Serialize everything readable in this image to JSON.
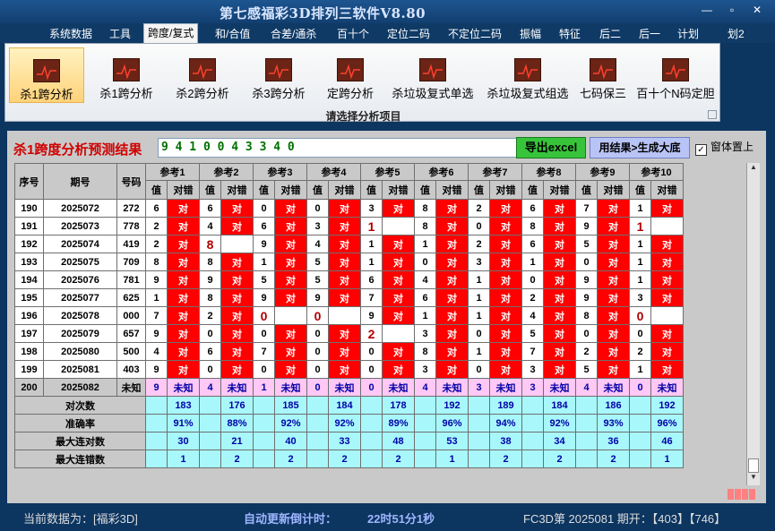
{
  "window": {
    "title": "第七感福彩3D排列三软件V8.80",
    "minimize": "—",
    "maximize": "▫",
    "close": "✕"
  },
  "menu": [
    "系统数据",
    "工具",
    "跨度/复式",
    "和/合值",
    "合差/通杀",
    "百十个",
    "定位二码",
    "不定位二码",
    "振幅",
    "特征",
    "后二",
    "后一",
    "计划",
    "划2"
  ],
  "ribbon": {
    "buttons": [
      "杀1跨分析",
      "杀1跨分析",
      "杀2跨分析",
      "杀3跨分析",
      "定跨分析",
      "杀垃圾复式单选",
      "杀垃圾复式组选",
      "七码保三",
      "百十个N码定胆"
    ],
    "caption": "请选择分析项目"
  },
  "result": {
    "label": "杀1跨度分析预测结果",
    "value": "9 4 1 0 0 4 3 3 4 0",
    "export_btn": "导出excel",
    "gen_btn": "用结果>生成大底",
    "topmost_label": "窗体置上",
    "topmost_checked": "✓"
  },
  "table": {
    "headers": [
      "序号",
      "期号",
      "号码"
    ],
    "refs": [
      "参考1",
      "参考2",
      "参考3",
      "参考4",
      "参考5",
      "参考6",
      "参考7",
      "参考8",
      "参考9",
      "参考10"
    ],
    "subheaders": [
      "值",
      "对错"
    ],
    "rows": [
      {
        "seq": "190",
        "period": "2025072",
        "num": "272",
        "cells": [
          [
            "6",
            "对"
          ],
          [
            "6",
            "对"
          ],
          [
            "0",
            "对"
          ],
          [
            "0",
            "对"
          ],
          [
            "3",
            "对"
          ],
          [
            "8",
            "对"
          ],
          [
            "2",
            "对"
          ],
          [
            "6",
            "对"
          ],
          [
            "7",
            "对"
          ],
          [
            "1",
            "对"
          ]
        ]
      },
      {
        "seq": "191",
        "period": "2025073",
        "num": "778",
        "cells": [
          [
            "2",
            "对"
          ],
          [
            "4",
            "对"
          ],
          [
            "6",
            "对"
          ],
          [
            "3",
            "对"
          ],
          [
            "1",
            ""
          ],
          [
            "8",
            "对"
          ],
          [
            "0",
            "对"
          ],
          [
            "8",
            "对"
          ],
          [
            "9",
            "对"
          ],
          [
            "1",
            ""
          ]
        ]
      },
      {
        "seq": "192",
        "period": "2025074",
        "num": "419",
        "cells": [
          [
            "2",
            "对"
          ],
          [
            "8",
            ""
          ],
          [
            "9",
            "对"
          ],
          [
            "4",
            "对"
          ],
          [
            "1",
            "对"
          ],
          [
            "1",
            "对"
          ],
          [
            "2",
            "对"
          ],
          [
            "6",
            "对"
          ],
          [
            "5",
            "对"
          ],
          [
            "1",
            "对"
          ]
        ]
      },
      {
        "seq": "193",
        "period": "2025075",
        "num": "709",
        "cells": [
          [
            "8",
            "对"
          ],
          [
            "8",
            "对"
          ],
          [
            "1",
            "对"
          ],
          [
            "5",
            "对"
          ],
          [
            "1",
            "对"
          ],
          [
            "0",
            "对"
          ],
          [
            "3",
            "对"
          ],
          [
            "1",
            "对"
          ],
          [
            "0",
            "对"
          ],
          [
            "1",
            "对"
          ]
        ]
      },
      {
        "seq": "194",
        "period": "2025076",
        "num": "781",
        "cells": [
          [
            "9",
            "对"
          ],
          [
            "9",
            "对"
          ],
          [
            "5",
            "对"
          ],
          [
            "5",
            "对"
          ],
          [
            "6",
            "对"
          ],
          [
            "4",
            "对"
          ],
          [
            "1",
            "对"
          ],
          [
            "0",
            "对"
          ],
          [
            "9",
            "对"
          ],
          [
            "1",
            "对"
          ]
        ]
      },
      {
        "seq": "195",
        "period": "2025077",
        "num": "625",
        "cells": [
          [
            "1",
            "对"
          ],
          [
            "8",
            "对"
          ],
          [
            "9",
            "对"
          ],
          [
            "9",
            "对"
          ],
          [
            "7",
            "对"
          ],
          [
            "6",
            "对"
          ],
          [
            "1",
            "对"
          ],
          [
            "2",
            "对"
          ],
          [
            "9",
            "对"
          ],
          [
            "3",
            "对"
          ]
        ]
      },
      {
        "seq": "196",
        "period": "2025078",
        "num": "000",
        "cells": [
          [
            "7",
            "对"
          ],
          [
            "2",
            "对"
          ],
          [
            "0",
            ""
          ],
          [
            "0",
            ""
          ],
          [
            "9",
            "对"
          ],
          [
            "1",
            "对"
          ],
          [
            "1",
            "对"
          ],
          [
            "4",
            "对"
          ],
          [
            "8",
            "对"
          ],
          [
            "0",
            ""
          ]
        ]
      },
      {
        "seq": "197",
        "period": "2025079",
        "num": "657",
        "cells": [
          [
            "9",
            "对"
          ],
          [
            "0",
            "对"
          ],
          [
            "0",
            "对"
          ],
          [
            "0",
            "对"
          ],
          [
            "2",
            ""
          ],
          [
            "3",
            "对"
          ],
          [
            "0",
            "对"
          ],
          [
            "5",
            "对"
          ],
          [
            "0",
            "对"
          ],
          [
            "0",
            "对"
          ]
        ]
      },
      {
        "seq": "198",
        "period": "2025080",
        "num": "500",
        "cells": [
          [
            "4",
            "对"
          ],
          [
            "6",
            "对"
          ],
          [
            "7",
            "对"
          ],
          [
            "0",
            "对"
          ],
          [
            "0",
            "对"
          ],
          [
            "8",
            "对"
          ],
          [
            "1",
            "对"
          ],
          [
            "7",
            "对"
          ],
          [
            "2",
            "对"
          ],
          [
            "2",
            "对"
          ]
        ]
      },
      {
        "seq": "199",
        "period": "2025081",
        "num": "403",
        "cells": [
          [
            "9",
            "对"
          ],
          [
            "0",
            "对"
          ],
          [
            "0",
            "对"
          ],
          [
            "0",
            "对"
          ],
          [
            "0",
            "对"
          ],
          [
            "3",
            "对"
          ],
          [
            "0",
            "对"
          ],
          [
            "3",
            "对"
          ],
          [
            "5",
            "对"
          ],
          [
            "1",
            "对"
          ]
        ]
      }
    ],
    "unknown_row": {
      "seq": "200",
      "period": "2025082",
      "num": "未知",
      "cells": [
        [
          "9",
          "未知"
        ],
        [
          "4",
          "未知"
        ],
        [
          "1",
          "未知"
        ],
        [
          "0",
          "未知"
        ],
        [
          "0",
          "未知"
        ],
        [
          "4",
          "未知"
        ],
        [
          "3",
          "未知"
        ],
        [
          "3",
          "未知"
        ],
        [
          "4",
          "未知"
        ],
        [
          "0",
          "未知"
        ]
      ]
    },
    "stats": [
      {
        "label": "对次数",
        "values": [
          "183",
          "176",
          "185",
          "184",
          "178",
          "192",
          "189",
          "184",
          "186",
          "192"
        ]
      },
      {
        "label": "准确率",
        "values": [
          "91%",
          "88%",
          "92%",
          "92%",
          "89%",
          "96%",
          "94%",
          "92%",
          "93%",
          "96%"
        ]
      },
      {
        "label": "最大连对数",
        "values": [
          "30",
          "21",
          "40",
          "33",
          "48",
          "53",
          "38",
          "34",
          "36",
          "46"
        ]
      },
      {
        "label": "最大连错数",
        "values": [
          "1",
          "2",
          "2",
          "2",
          "2",
          "1",
          "2",
          "2",
          "2",
          "1"
        ]
      }
    ]
  },
  "status": {
    "current": "当前数据为：[福彩3D]",
    "countdown_label": "自动更新倒计时：",
    "countdown": "22时51分1秒",
    "draw": "FC3D第 2025081 期开：【403】【746】"
  }
}
